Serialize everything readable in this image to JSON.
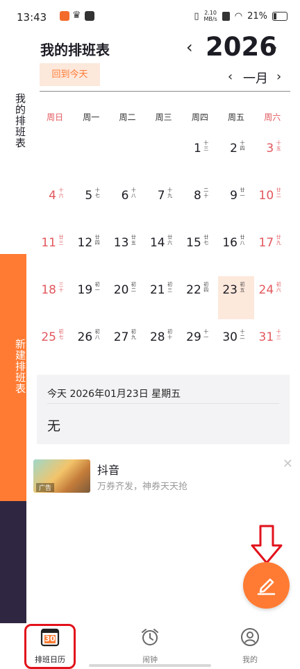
{
  "status_bar": {
    "time": "13:43",
    "speed_value": "2.10",
    "speed_unit": "MB/s",
    "battery": "21%"
  },
  "sidebar": {
    "my_schedule": "我的排班表",
    "new_schedule": "新建排班表"
  },
  "header": {
    "title": "我的排班表",
    "year": "2026",
    "today_button": "回到今天",
    "month": "一月"
  },
  "weekdays": [
    "周日",
    "周一",
    "周二",
    "周三",
    "周四",
    "周五",
    "周六"
  ],
  "calendar": {
    "days": [
      {
        "day": "1",
        "lunar": "十三",
        "col": 4,
        "row": 0
      },
      {
        "day": "2",
        "lunar": "十四",
        "col": 5,
        "row": 0
      },
      {
        "day": "3",
        "lunar": "十五",
        "col": 6,
        "row": 0
      },
      {
        "day": "4",
        "lunar": "十六",
        "col": 0,
        "row": 1
      },
      {
        "day": "5",
        "lunar": "十七",
        "col": 1,
        "row": 1
      },
      {
        "day": "6",
        "lunar": "十八",
        "col": 2,
        "row": 1
      },
      {
        "day": "7",
        "lunar": "十九",
        "col": 3,
        "row": 1
      },
      {
        "day": "8",
        "lunar": "二十",
        "col": 4,
        "row": 1
      },
      {
        "day": "9",
        "lunar": "廿一",
        "col": 5,
        "row": 1
      },
      {
        "day": "10",
        "lunar": "廿二",
        "col": 6,
        "row": 1
      },
      {
        "day": "11",
        "lunar": "廿三",
        "col": 0,
        "row": 2
      },
      {
        "day": "12",
        "lunar": "廿四",
        "col": 1,
        "row": 2
      },
      {
        "day": "13",
        "lunar": "廿五",
        "col": 2,
        "row": 2
      },
      {
        "day": "14",
        "lunar": "廿六",
        "col": 3,
        "row": 2
      },
      {
        "day": "15",
        "lunar": "廿七",
        "col": 4,
        "row": 2
      },
      {
        "day": "16",
        "lunar": "廿八",
        "col": 5,
        "row": 2
      },
      {
        "day": "17",
        "lunar": "廿九",
        "col": 6,
        "row": 2
      },
      {
        "day": "18",
        "lunar": "三十",
        "col": 0,
        "row": 3
      },
      {
        "day": "19",
        "lunar": "初一",
        "col": 1,
        "row": 3
      },
      {
        "day": "20",
        "lunar": "初二",
        "col": 2,
        "row": 3
      },
      {
        "day": "21",
        "lunar": "初三",
        "col": 3,
        "row": 3
      },
      {
        "day": "22",
        "lunar": "初四",
        "col": 4,
        "row": 3
      },
      {
        "day": "23",
        "lunar": "初五",
        "col": 5,
        "row": 3,
        "today": true
      },
      {
        "day": "24",
        "lunar": "初六",
        "col": 6,
        "row": 3
      },
      {
        "day": "25",
        "lunar": "初七",
        "col": 0,
        "row": 4
      },
      {
        "day": "26",
        "lunar": "初八",
        "col": 1,
        "row": 4
      },
      {
        "day": "27",
        "lunar": "初九",
        "col": 2,
        "row": 4
      },
      {
        "day": "28",
        "lunar": "初十",
        "col": 3,
        "row": 4
      },
      {
        "day": "29",
        "lunar": "十一",
        "col": 4,
        "row": 4
      },
      {
        "day": "30",
        "lunar": "十二",
        "col": 5,
        "row": 4
      },
      {
        "day": "31",
        "lunar": "十三",
        "col": 6,
        "row": 4
      }
    ]
  },
  "info": {
    "date_line": "今天 2026年01月23日 星期五",
    "schedule": "无"
  },
  "ad": {
    "app_name": "抖音",
    "description": "万券齐发，神券天天抢",
    "tag": "广告"
  },
  "tabs": [
    {
      "label": "排班日历",
      "icon_text": "30",
      "icon": "calendar-icon"
    },
    {
      "label": "闹钟",
      "icon": "alarm-clock-icon"
    },
    {
      "label": "我的",
      "icon": "user-icon"
    }
  ],
  "colors": {
    "accent": "#ff7b33",
    "weekend": "#e2575d",
    "dark_sidebar": "#2f2742",
    "highlight": "#e2111b"
  }
}
